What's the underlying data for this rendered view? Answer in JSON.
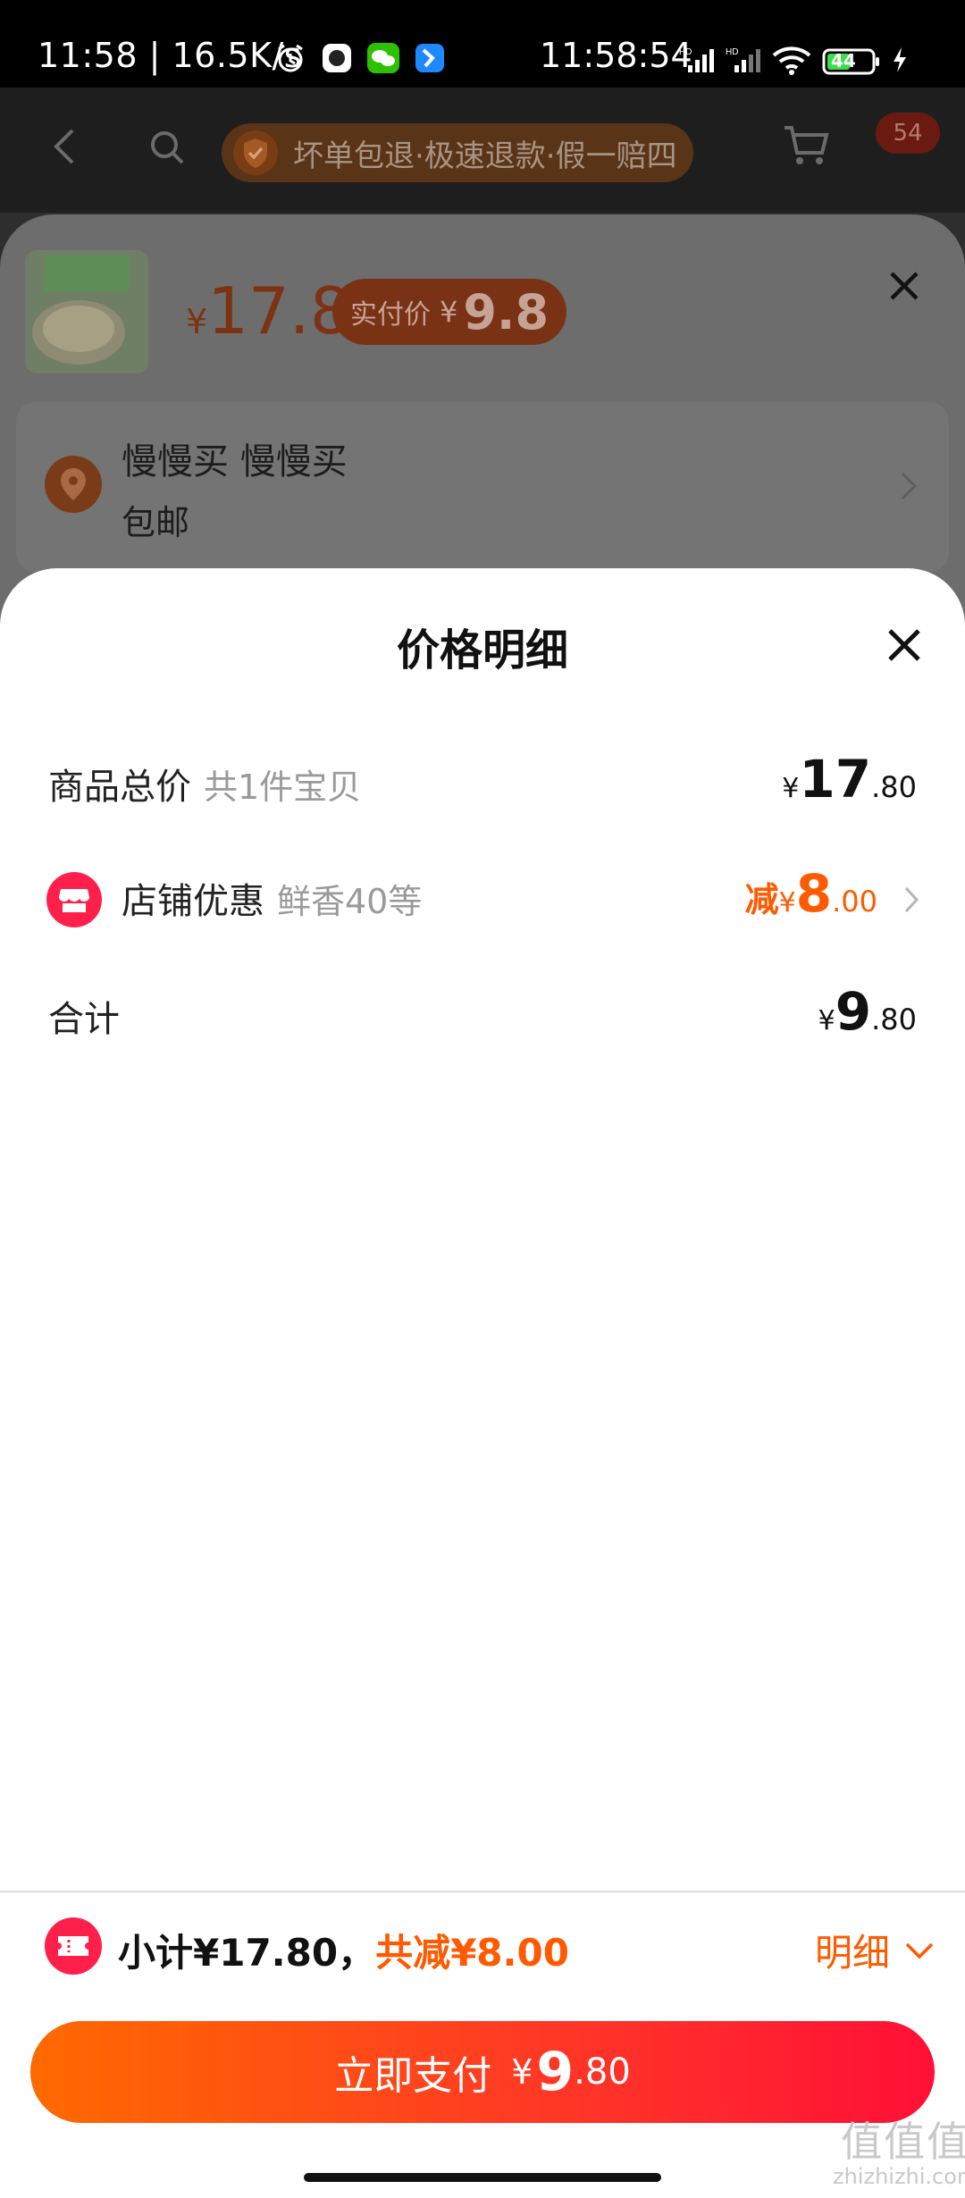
{
  "status_bar": {
    "left_text": "11:58 | 16.5K/s",
    "clock": "11:58:54",
    "battery": "44",
    "icons": [
      "alarm-icon",
      "app-icon",
      "wechat-icon",
      "feishu-icon",
      "signal-icon",
      "signal-icon",
      "wifi-icon",
      "battery-icon",
      "charging-icon"
    ]
  },
  "background_page": {
    "promo_text": "坏单包退·极速退款·假一赔四",
    "message_badge": "54",
    "sku": {
      "currency": "¥",
      "price": "17.8",
      "paid_label": "实付价",
      "paid_currency": "¥",
      "paid_price": "9.8"
    },
    "address": {
      "name": "慢慢买 慢慢买",
      "shipping": "包邮"
    }
  },
  "price_detail": {
    "title": "价格明细",
    "rows": [
      {
        "label": "商品总价",
        "sub": "共1件宝贝",
        "currency": "¥",
        "int": "17",
        "dec": ".80"
      },
      {
        "label": "店铺优惠",
        "sub": "鲜香40等",
        "prefix": "减",
        "currency": "¥",
        "int": "8",
        "dec": ".00"
      },
      {
        "label": "合计",
        "currency": "¥",
        "int": "9",
        "dec": ".80"
      }
    ]
  },
  "bottom_bar": {
    "subtotal_text": "小计¥17.80，",
    "reduce_text": "共减¥8.00",
    "detail_label": "明细"
  },
  "pay_button": {
    "label": "立即支付",
    "currency": "¥",
    "int": "9",
    "dec": ".80"
  },
  "watermark": {
    "mark": "值值值",
    "site": "zhizhizhi.com"
  },
  "colors": {
    "accent": "#ff5a00",
    "brand_red": "#ff1f4b",
    "pay_gradient_start": "#ff6a00",
    "pay_gradient_end": "#ff1037"
  }
}
